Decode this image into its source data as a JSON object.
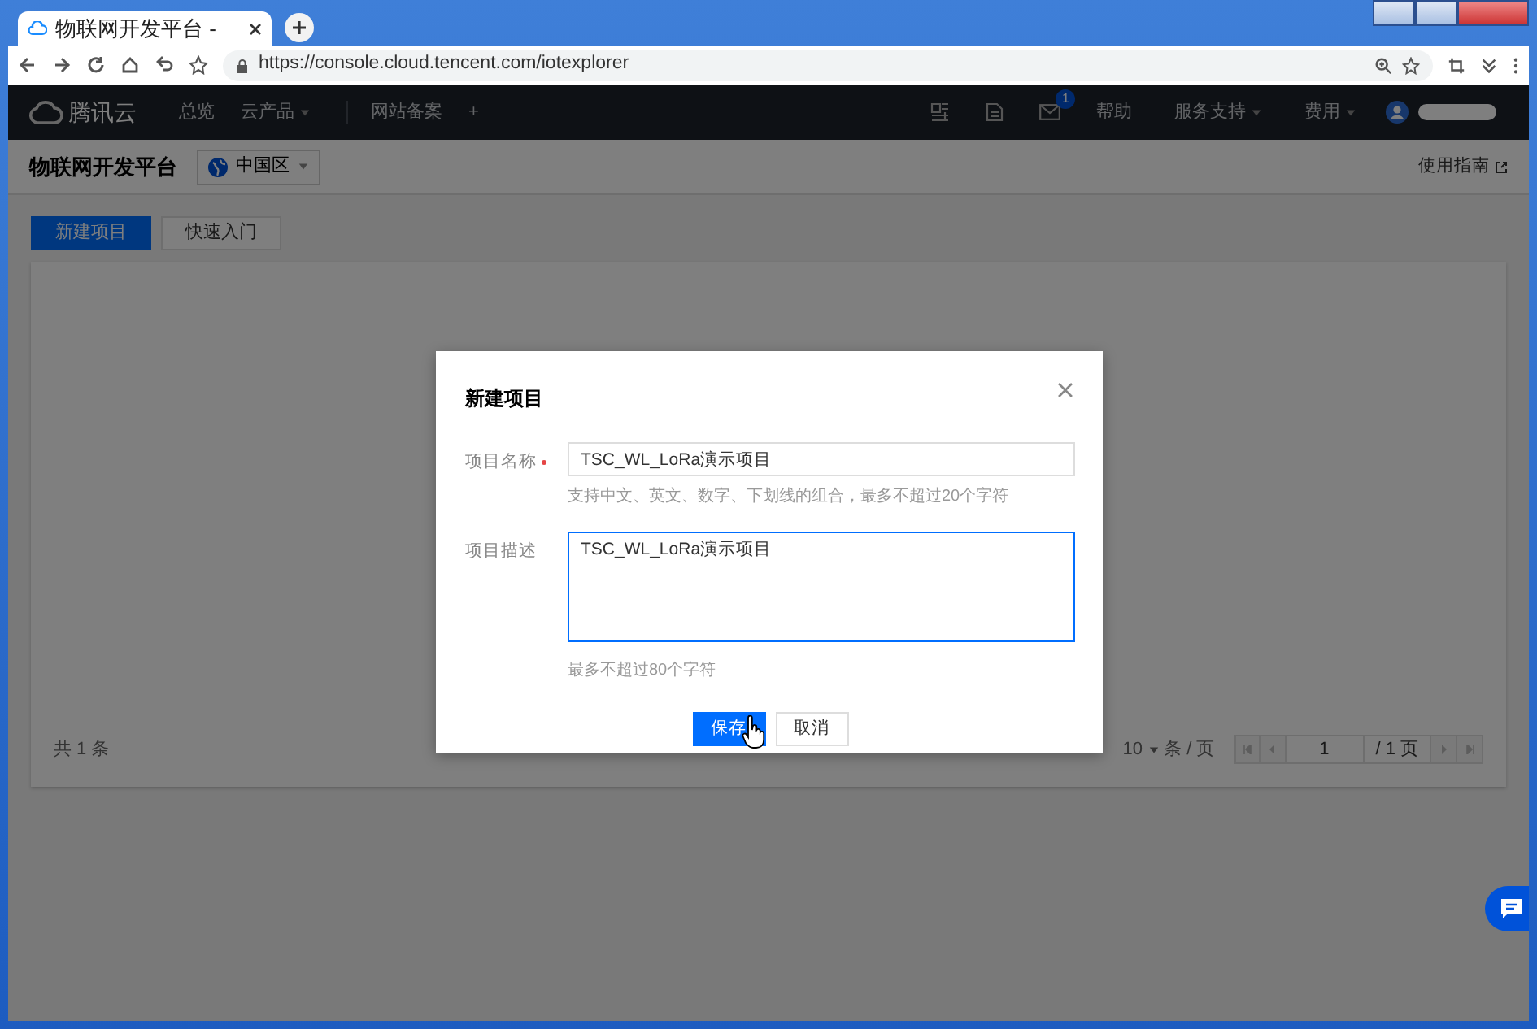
{
  "browser": {
    "tab_title": "物联网开发平台 -",
    "url": "https://console.cloud.tencent.com/iotexplorer"
  },
  "topnav": {
    "brand": "腾讯云",
    "left_items": [
      {
        "label": "总览",
        "dropdown": false
      },
      {
        "label": "云产品",
        "dropdown": true
      },
      {
        "label": "网站备案",
        "dropdown": false
      },
      {
        "label": "+",
        "dropdown": false
      }
    ],
    "right_items": [
      {
        "label": "帮助",
        "dropdown": false
      },
      {
        "label": "服务支持",
        "dropdown": true
      },
      {
        "label": "费用",
        "dropdown": true
      }
    ],
    "mail_badge": "1"
  },
  "page_header": {
    "title": "物联网开发平台",
    "region": "中国区",
    "guide_link": "使用指南"
  },
  "actions": [
    {
      "label": "新建项目",
      "kind": "primary"
    },
    {
      "label": "快速入门",
      "kind": "default"
    }
  ],
  "list_footer": {
    "total": "共 1 条",
    "page_size": "10",
    "per_page_label": "条 / 页",
    "page_input": "1",
    "page_total": "/ 1 页"
  },
  "modal": {
    "title": "新建项目",
    "fields": [
      {
        "label": "项目名称",
        "required": true,
        "kind": "input",
        "value": "TSC_WL_LoRa演示项目",
        "hint": "支持中文、英文、数字、下划线的组合，最多不超过20个字符",
        "focused": false
      },
      {
        "label": "项目描述",
        "required": false,
        "kind": "textarea",
        "value": "TSC_WL_LoRa演示项目",
        "hint": "最多不超过80个字符",
        "focused": true
      }
    ],
    "buttons": [
      {
        "label": "保存",
        "kind": "primary"
      },
      {
        "label": "取消",
        "kind": "default"
      }
    ]
  }
}
